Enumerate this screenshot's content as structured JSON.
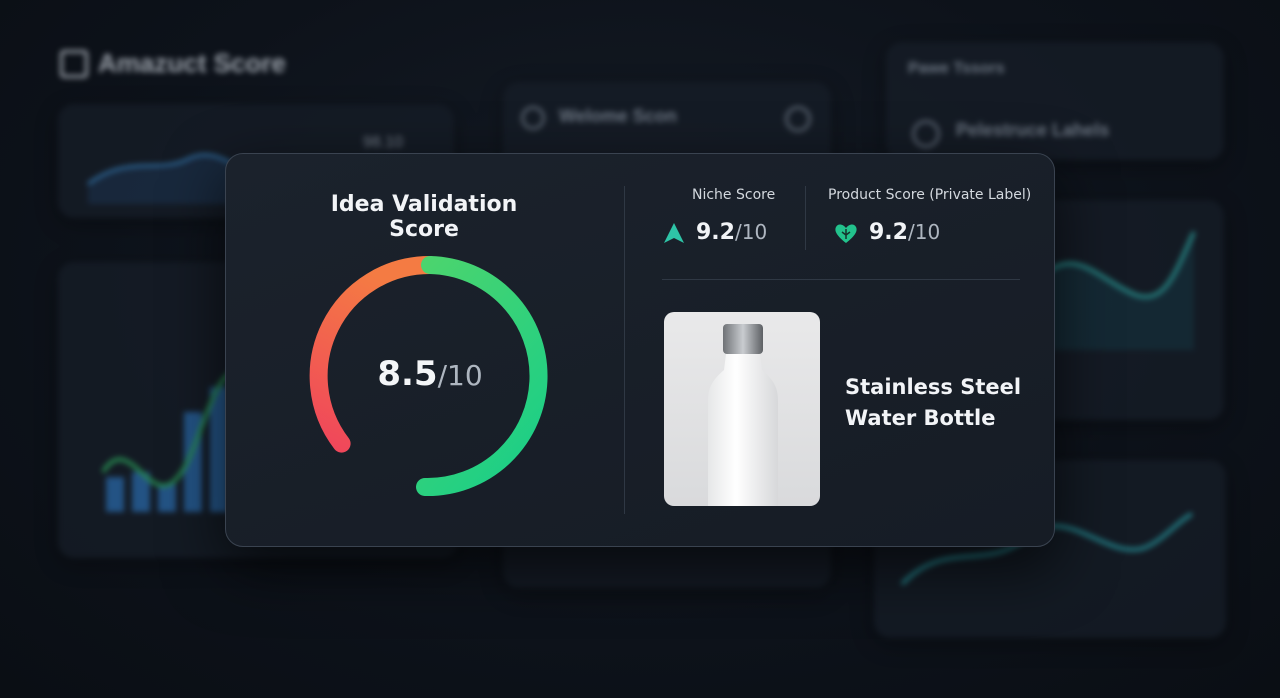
{
  "background": {
    "app_title": "Amazuct Score",
    "panel_center_title": "Welome Scon",
    "panel_right_title": "Pawe Tssors",
    "panel_right_subtitle": "Pelestruce Lahels",
    "panel_left_value": "98.10"
  },
  "card": {
    "title": "Idea Validation Score",
    "gauge": {
      "value": "8.5",
      "denominator": "/10",
      "fraction": 0.85
    },
    "niche": {
      "label": "Niche Score",
      "value": "9.2",
      "denominator": "/10",
      "icon": "triangle-up-icon"
    },
    "product_score": {
      "label": "Product Score (Private Label)",
      "value": "9.2",
      "denominator": "/10",
      "icon": "heart-leaf-icon"
    },
    "product": {
      "name_line1": "Stainless Steel",
      "name_line2": "Water Bottle"
    }
  },
  "colors": {
    "accent_green": "#22d07a",
    "accent_teal": "#2ec4a7",
    "gauge_red": "#f0465b",
    "gauge_orange": "#f47b43",
    "card_bg": "#1b222c"
  }
}
